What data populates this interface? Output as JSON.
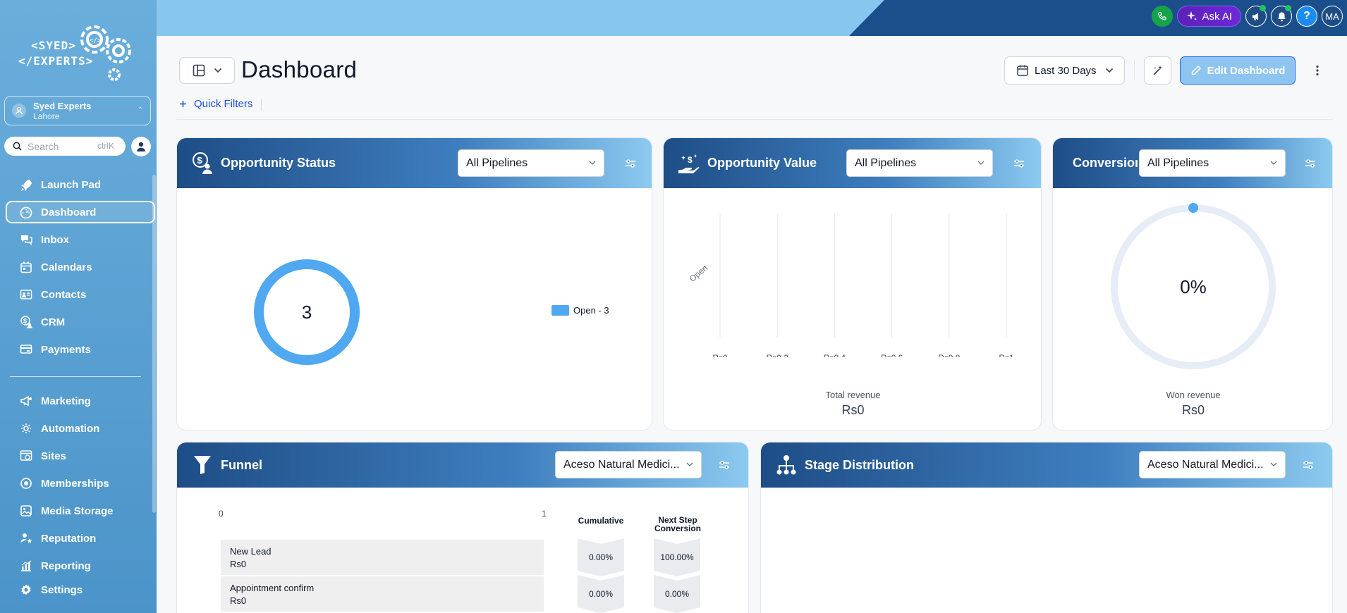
{
  "brand": {
    "logo_line1": "<SYED>",
    "logo_line2": "</EXPERTS>"
  },
  "location": {
    "name": "Syed Experts",
    "city": "Lahore"
  },
  "search": {
    "placeholder": "Search",
    "shortcut": "ctrlK"
  },
  "nav": {
    "primary": [
      {
        "label": "Launch Pad",
        "icon": "rocket-icon"
      },
      {
        "label": "Dashboard",
        "icon": "gauge-icon",
        "active": true
      },
      {
        "label": "Inbox",
        "icon": "chat-icon"
      },
      {
        "label": "Calendars",
        "icon": "calendar-icon"
      },
      {
        "label": "Contacts",
        "icon": "contact-card-icon"
      },
      {
        "label": "CRM",
        "icon": "dollar-user-icon"
      },
      {
        "label": "Payments",
        "icon": "payments-icon"
      }
    ],
    "secondary": [
      {
        "label": "Marketing",
        "icon": "megaphone-icon"
      },
      {
        "label": "Automation",
        "icon": "gear-cycle-icon"
      },
      {
        "label": "Sites",
        "icon": "globe-icon"
      },
      {
        "label": "Memberships",
        "icon": "badge-icon"
      },
      {
        "label": "Media Storage",
        "icon": "image-icon"
      },
      {
        "label": "Reputation",
        "icon": "star-user-icon"
      },
      {
        "label": "Reporting",
        "icon": "bar-chart-icon"
      },
      {
        "label": "Settings",
        "icon": "gear-icon"
      }
    ]
  },
  "topbar": {
    "ask_ai": "Ask AI",
    "avatar_initials": "MA",
    "help": "?"
  },
  "header": {
    "title": "Dashboard",
    "date_range": "Last 30 Days",
    "edit_label": "Edit Dashboard",
    "quick_filters": "Quick Filters"
  },
  "cards": {
    "opportunity_status": {
      "title": "Opportunity Status",
      "filter": "All Pipelines",
      "center_value": "3",
      "legend": "Open - 3"
    },
    "opportunity_value": {
      "title": "Opportunity Value",
      "filter": "All Pipelines",
      "footer_label": "Total revenue",
      "footer_value": "Rs0"
    },
    "conversion": {
      "title": "Conversion",
      "filter": "All Pipelines",
      "percent": "0%",
      "footer_label": "Won revenue",
      "footer_value": "Rs0"
    },
    "funnel": {
      "title": "Funnel",
      "filter": "Aceso Natural Medici...",
      "axis_min": "0",
      "axis_max": "1",
      "col_cumulative": "Cumulative",
      "col_next_line1": "Next Step",
      "col_next_line2": "Conversion",
      "rows": [
        {
          "stage": "New Lead",
          "value": "Rs0",
          "cumulative": "0.00%",
          "next": "100.00%"
        },
        {
          "stage": "Appointment confirm",
          "value": "Rs0",
          "cumulative": "0.00%",
          "next": "0.00%"
        }
      ]
    },
    "stage_distribution": {
      "title": "Stage Distribution",
      "filter": "Aceso Natural Medici..."
    }
  },
  "chart_data": [
    {
      "type": "pie",
      "title": "Opportunity Status",
      "categories": [
        "Open"
      ],
      "values": [
        3
      ],
      "colors": [
        "#4fa8f0"
      ]
    },
    {
      "type": "bar",
      "title": "Opportunity Value",
      "orientation": "horizontal",
      "categories": [
        "Open"
      ],
      "values": [
        0
      ],
      "xlim": [
        0,
        1
      ],
      "x_ticks": [
        "Rs0",
        "Rs0.2",
        "Rs0.4",
        "Rs0.6",
        "Rs0.8",
        "Rs1"
      ],
      "grid": true
    },
    {
      "type": "pie",
      "title": "Conversion",
      "values": [
        0
      ],
      "label": "0%"
    }
  ],
  "colors": {
    "accent": "#4fa8f0",
    "header_dark": "#1e4d86",
    "sidebar": "#5ba2d5",
    "topbar_dark": "#1b4f8c"
  }
}
